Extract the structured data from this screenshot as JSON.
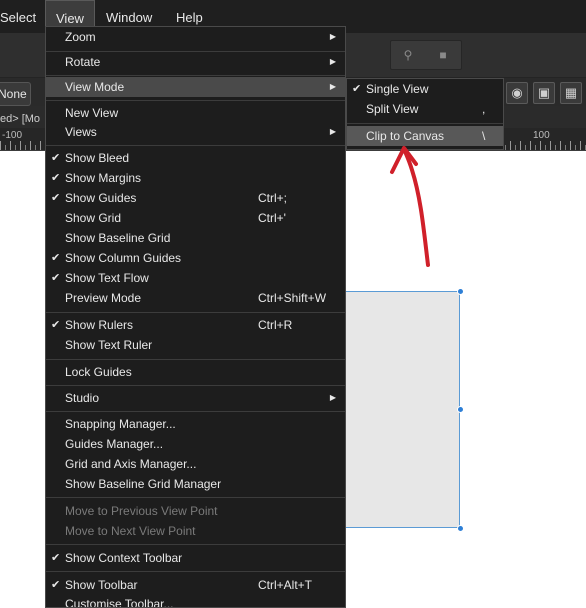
{
  "menubar": {
    "select": "Select",
    "view": "View",
    "window": "Window",
    "help": "Help"
  },
  "toolbar": {
    "pin_icon": "pin-icon",
    "square_icon": "square-icon"
  },
  "context": {
    "none_label": "None",
    "icons": [
      "eye-icon",
      "align-center-icon",
      "transform-icon"
    ]
  },
  "document": {
    "tab_title": "ed> [Mo"
  },
  "ruler": {
    "labels": [
      "-100",
      "100"
    ]
  },
  "view_menu": {
    "items": [
      {
        "label": "Zoom",
        "submenu": true
      },
      {
        "label": "Rotate",
        "submenu": true
      },
      {
        "label": "View Mode",
        "submenu": true,
        "active": true
      },
      {
        "label": "New View"
      },
      {
        "label": "Views",
        "submenu": true
      },
      {
        "label": "Show Bleed",
        "checked": true
      },
      {
        "label": "Show Margins",
        "checked": true
      },
      {
        "label": "Show Guides",
        "checked": true,
        "shortcut": "Ctrl+;"
      },
      {
        "label": "Show Grid",
        "shortcut": "Ctrl+'"
      },
      {
        "label": "Show Baseline Grid"
      },
      {
        "label": "Show Column Guides",
        "checked": true
      },
      {
        "label": "Show Text Flow",
        "checked": true
      },
      {
        "label": "Preview Mode",
        "shortcut": "Ctrl+Shift+W"
      },
      {
        "label": "Show Rulers",
        "checked": true,
        "shortcut": "Ctrl+R"
      },
      {
        "label": "Show Text Ruler"
      },
      {
        "label": "Lock Guides"
      },
      {
        "label": "Studio",
        "submenu": true
      },
      {
        "label": "Snapping Manager..."
      },
      {
        "label": "Guides Manager..."
      },
      {
        "label": "Grid and Axis Manager..."
      },
      {
        "label": "Show Baseline Grid Manager"
      },
      {
        "label": "Move to Previous View Point",
        "disabled": true
      },
      {
        "label": "Move to Next View Point",
        "disabled": true
      },
      {
        "label": "Show Context Toolbar",
        "checked": true
      },
      {
        "label": "Show Toolbar",
        "checked": true,
        "shortcut": "Ctrl+Alt+T"
      },
      {
        "label": "Customise Toolbar..."
      }
    ]
  },
  "view_mode_submenu": {
    "items": [
      {
        "label": "Single View",
        "checked": true,
        "shortcut": ""
      },
      {
        "label": "Split View",
        "shortcut": ","
      },
      {
        "label": "Clip to Canvas",
        "shortcut": "\\",
        "highlighted": true
      }
    ]
  },
  "colors": {
    "annotation_arrow": "#d0202a",
    "selection_handle": "#2e7fd6",
    "menu_highlight": "#585858"
  }
}
